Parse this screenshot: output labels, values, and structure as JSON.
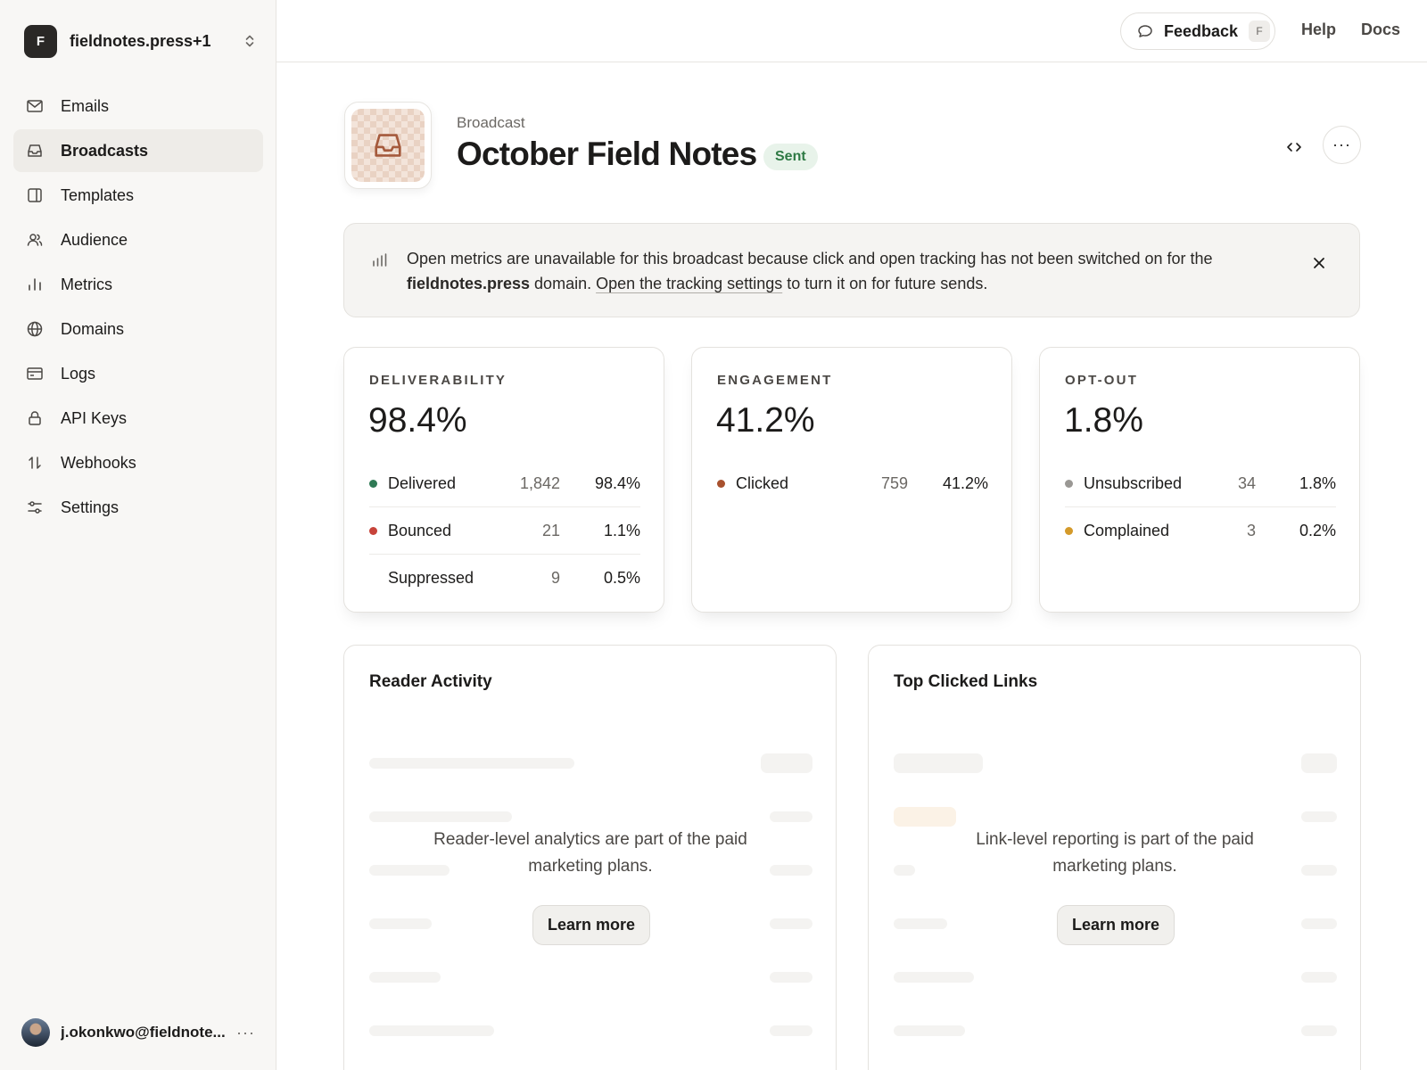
{
  "sidebar": {
    "workspace": {
      "initial": "F",
      "name": "fieldnotes.press+1"
    },
    "items": [
      {
        "label": "Emails",
        "icon": "mail-icon"
      },
      {
        "label": "Broadcasts",
        "icon": "inbox-icon",
        "active": true
      },
      {
        "label": "Templates",
        "icon": "template-icon"
      },
      {
        "label": "Audience",
        "icon": "users-icon"
      },
      {
        "label": "Metrics",
        "icon": "bar-chart-icon"
      },
      {
        "label": "Domains",
        "icon": "globe-icon"
      },
      {
        "label": "Logs",
        "icon": "log-icon"
      },
      {
        "label": "API Keys",
        "icon": "lock-icon"
      },
      {
        "label": "Webhooks",
        "icon": "webhook-icon"
      },
      {
        "label": "Settings",
        "icon": "sliders-icon"
      }
    ],
    "user": {
      "email": "j.okonkwo@fieldnote...",
      "more": "···"
    }
  },
  "topbar": {
    "feedback_label": "Feedback",
    "feedback_shortcut": "F",
    "help": "Help",
    "docs": "Docs"
  },
  "header": {
    "kicker": "Broadcast",
    "title": "October Field Notes",
    "status": "Sent",
    "more": "···"
  },
  "banner": {
    "text_before": "Open metrics are unavailable for this broadcast because click and open tracking has not been switched on for the ",
    "domain": "fieldnotes.press",
    "text_middle": " domain. ",
    "link": "Open the tracking settings",
    "text_after": " to turn it on for future sends."
  },
  "stats": [
    {
      "label": "DELIVERABILITY",
      "value": "98.4%",
      "rows": [
        {
          "label": "Delivered",
          "count": "1,842",
          "pct": "98.4%",
          "color": "#2f7a55"
        },
        {
          "label": "Bounced",
          "count": "21",
          "pct": "1.1%",
          "color": "#c7433a"
        },
        {
          "label": "Suppressed",
          "count": "9",
          "pct": "0.5%",
          "color": ""
        }
      ]
    },
    {
      "label": "ENGAGEMENT",
      "value": "41.2%",
      "rows": [
        {
          "label": "Clicked",
          "count": "759",
          "pct": "41.2%",
          "color": "#a8512e"
        }
      ]
    },
    {
      "label": "OPT-OUT",
      "value": "1.8%",
      "rows": [
        {
          "label": "Unsubscribed",
          "count": "34",
          "pct": "1.8%",
          "color": "#9a9894"
        },
        {
          "label": "Complained",
          "count": "3",
          "pct": "0.2%",
          "color": "#d49a2a"
        }
      ]
    }
  ],
  "panels": [
    {
      "title": "Reader Activity",
      "message": "Reader-level analytics are part of the paid marketing plans.",
      "button": "Learn more"
    },
    {
      "title": "Top Clicked Links",
      "message": "Link-level reporting is part of the paid marketing plans.",
      "button": "Learn more"
    }
  ]
}
